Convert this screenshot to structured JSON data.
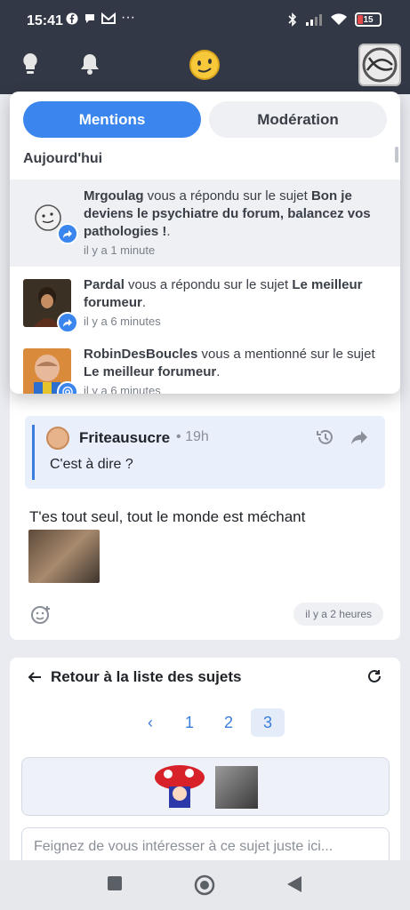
{
  "status_bar": {
    "time": "15:41",
    "battery": "15"
  },
  "dropdown": {
    "tabs": [
      {
        "label": "Mentions",
        "active": true
      },
      {
        "label": "Modération",
        "active": false
      }
    ],
    "section_title": "Aujourd'hui",
    "notifications": [
      {
        "user": "Mrgoulag",
        "action": " vous a répondu sur le sujet ",
        "topic": "Bon je deviens le psychiatre du forum, balancez vos pathologies !",
        "suffix": ".",
        "ago": "il y a 1 minute",
        "type": "reply",
        "unread": true
      },
      {
        "user": "Pardal",
        "action": " vous a répondu sur le sujet ",
        "topic": "Le meilleur forumeur",
        "suffix": ".",
        "ago": "il y a 6 minutes",
        "type": "reply",
        "unread": false
      },
      {
        "user": "RobinDesBoucles",
        "action": " vous a mentionné sur le sujet ",
        "topic": "Le meilleur forumeur",
        "suffix": ".",
        "ago": "il y a 6 minutes",
        "type": "mention",
        "unread": false
      }
    ]
  },
  "post": {
    "quote": {
      "author": "Friteausucre",
      "separator": "•",
      "time": "19h",
      "text": "C'est à dire ?"
    },
    "text": "T'es tout seul, tout le monde est méchant",
    "timestamp": "il y a 2 heures"
  },
  "footer_panel": {
    "back_label": "Retour à la liste des sujets",
    "pagination": {
      "prev": "‹",
      "pages": [
        "1",
        "2",
        "3"
      ],
      "current": "3"
    },
    "input_placeholder": "Feignez de vous intéresser à ce sujet juste ici..."
  },
  "colors": {
    "accent": "#3b85ee",
    "topbar": "#323846"
  }
}
